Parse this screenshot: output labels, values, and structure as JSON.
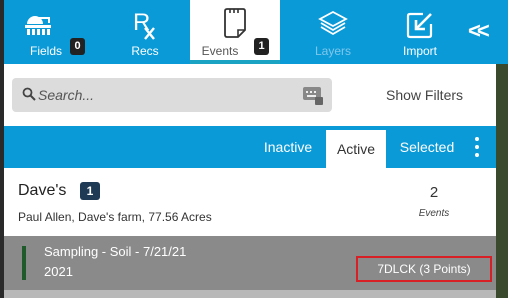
{
  "nav": {
    "fields": {
      "label": "Fields",
      "badge": "0",
      "icon": "fields-icon"
    },
    "recs": {
      "label": "Recs",
      "icon": "rx-icon"
    },
    "events": {
      "label": "Events",
      "badge": "1",
      "icon": "clipboard-icon"
    },
    "layers": {
      "label": "Layers",
      "icon": "layers-icon"
    },
    "import": {
      "label": "Import",
      "icon": "import-icon"
    },
    "collapse": {
      "label": "<<",
      "icon": "collapse-icon"
    }
  },
  "search": {
    "placeholder": "Search...",
    "value": ""
  },
  "filters": {
    "label": "Show Filters"
  },
  "tabs": [
    {
      "label": "Inactive"
    },
    {
      "label": "Active",
      "selected": true
    },
    {
      "label": "Selected"
    }
  ],
  "farm": {
    "name": "Dave's",
    "badge": "1",
    "description": "Paul Allen, Dave's farm, 77.56 Acres",
    "count": "2",
    "count_label": "Events"
  },
  "event": {
    "title": "Sampling - Soil - 7/21/21",
    "year": "2021",
    "tag": "7DLCK (3 Points)"
  },
  "colors": {
    "primary": "#0a9ad8",
    "badge_dark": "#222222",
    "farm_badge": "#1f3a55",
    "event_row": "#8a8a8a",
    "event_bar": "#1e5a2a",
    "highlight_border": "#d81f26"
  }
}
